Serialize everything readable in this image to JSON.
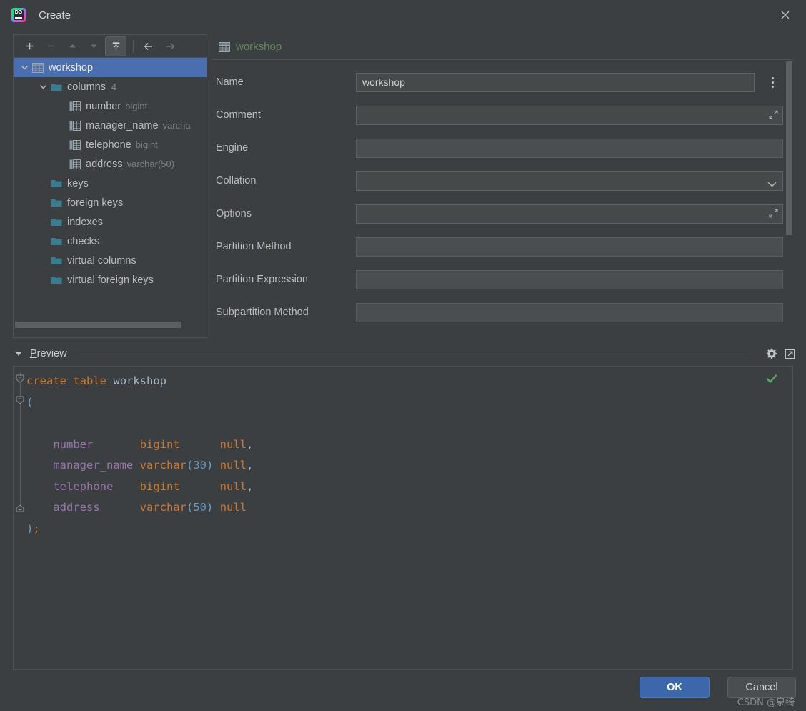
{
  "window": {
    "title": "Create",
    "logo_text": "DG",
    "close_icon": "close-icon"
  },
  "tree_toolbar": {
    "buttons": [
      {
        "name": "add-button",
        "icon": "plus-icon",
        "enabled": true
      },
      {
        "name": "remove-button",
        "icon": "minus-icon",
        "enabled": false
      },
      {
        "name": "move-up-button",
        "icon": "arrow-up-icon",
        "enabled": false
      },
      {
        "name": "move-down-button",
        "icon": "arrow-down-icon",
        "enabled": false
      },
      {
        "name": "expand-button",
        "icon": "push-up-icon",
        "enabled": true
      },
      {
        "name": "back-button",
        "icon": "arrow-left-icon",
        "enabled": true
      },
      {
        "name": "forward-button",
        "icon": "arrow-right-icon",
        "enabled": false
      }
    ]
  },
  "tree": {
    "nodes": [
      {
        "label": "workshop",
        "type": "",
        "count": "",
        "icon": "table-icon",
        "depth": 0,
        "selected": true,
        "expanded": true
      },
      {
        "label": "columns",
        "type": "",
        "count": "4",
        "icon": "folder-icon",
        "depth": 1,
        "selected": false,
        "expanded": true
      },
      {
        "label": "number",
        "type": "bigint",
        "count": "",
        "icon": "column-icon",
        "depth": 2,
        "selected": false,
        "expanded": null
      },
      {
        "label": "manager_name",
        "type": "varcha",
        "count": "",
        "icon": "column-icon",
        "depth": 2,
        "selected": false,
        "expanded": null
      },
      {
        "label": "telephone",
        "type": "bigint",
        "count": "",
        "icon": "column-icon",
        "depth": 2,
        "selected": false,
        "expanded": null
      },
      {
        "label": "address",
        "type": "varchar(50)",
        "count": "",
        "icon": "column-icon",
        "depth": 2,
        "selected": false,
        "expanded": null
      },
      {
        "label": "keys",
        "type": "",
        "count": "",
        "icon": "folder-icon",
        "depth": 1,
        "selected": false,
        "expanded": null
      },
      {
        "label": "foreign keys",
        "type": "",
        "count": "",
        "icon": "folder-icon",
        "depth": 1,
        "selected": false,
        "expanded": null
      },
      {
        "label": "indexes",
        "type": "",
        "count": "",
        "icon": "folder-icon",
        "depth": 1,
        "selected": false,
        "expanded": null
      },
      {
        "label": "checks",
        "type": "",
        "count": "",
        "icon": "folder-icon",
        "depth": 1,
        "selected": false,
        "expanded": null
      },
      {
        "label": "virtual columns",
        "type": "",
        "count": "",
        "icon": "folder-icon",
        "depth": 1,
        "selected": false,
        "expanded": null
      },
      {
        "label": "virtual foreign keys",
        "type": "",
        "count": "",
        "icon": "folder-icon",
        "depth": 1,
        "selected": false,
        "expanded": null
      }
    ]
  },
  "form": {
    "header_title": "workshop",
    "header_icon": "table-icon",
    "fields": [
      {
        "label": "Name",
        "value": "workshop",
        "control": "text",
        "disabled": false,
        "kebab": true,
        "expand": false,
        "chevron": false
      },
      {
        "label": "Comment",
        "value": "",
        "control": "textarea",
        "disabled": false,
        "kebab": false,
        "expand": true,
        "chevron": false
      },
      {
        "label": "Engine",
        "value": "",
        "control": "text",
        "disabled": true,
        "kebab": false,
        "expand": false,
        "chevron": false
      },
      {
        "label": "Collation",
        "value": "",
        "control": "combo",
        "disabled": false,
        "kebab": false,
        "expand": false,
        "chevron": true
      },
      {
        "label": "Options",
        "value": "",
        "control": "textarea",
        "disabled": false,
        "kebab": false,
        "expand": true,
        "chevron": false
      },
      {
        "label": "Partition Method",
        "value": "",
        "control": "text",
        "disabled": true,
        "kebab": false,
        "expand": false,
        "chevron": false
      },
      {
        "label": "Partition Expression",
        "value": "",
        "control": "text",
        "disabled": true,
        "kebab": false,
        "expand": false,
        "chevron": false
      },
      {
        "label": "Subpartition Method",
        "value": "",
        "control": "text",
        "disabled": true,
        "kebab": false,
        "expand": false,
        "chevron": false
      }
    ]
  },
  "preview": {
    "label_prefix": "P",
    "label_rest": "review",
    "collapse_icon": "triangle-down-icon",
    "settings_icon": "gear-icon",
    "popout_icon": "open-external-icon",
    "status_icon": "checkmark-icon"
  },
  "sql": {
    "lines": [
      [
        {
          "t": "create",
          "c": "kw"
        },
        {
          "t": " ",
          "c": "punc"
        },
        {
          "t": "table",
          "c": "kw"
        },
        {
          "t": " ",
          "c": "punc"
        },
        {
          "t": "workshop",
          "c": "tbl"
        }
      ],
      [
        {
          "t": "(",
          "c": "paren"
        }
      ],
      [
        {
          "t": "",
          "c": "punc"
        }
      ],
      [
        {
          "t": "    ",
          "c": "punc"
        },
        {
          "t": "number      ",
          "c": "ident"
        },
        {
          "t": " ",
          "c": "punc"
        },
        {
          "t": "bigint",
          "c": "kw"
        },
        {
          "t": "      ",
          "c": "punc"
        },
        {
          "t": "null",
          "c": "kw"
        },
        {
          "t": ",",
          "c": "punc"
        }
      ],
      [
        {
          "t": "    ",
          "c": "punc"
        },
        {
          "t": "manager_name",
          "c": "ident"
        },
        {
          "t": " ",
          "c": "punc"
        },
        {
          "t": "varchar",
          "c": "kw"
        },
        {
          "t": "(",
          "c": "paren"
        },
        {
          "t": "30",
          "c": "num"
        },
        {
          "t": ")",
          "c": "paren"
        },
        {
          "t": " ",
          "c": "punc"
        },
        {
          "t": "null",
          "c": "kw"
        },
        {
          "t": ",",
          "c": "punc"
        }
      ],
      [
        {
          "t": "    ",
          "c": "punc"
        },
        {
          "t": "telephone   ",
          "c": "ident"
        },
        {
          "t": " ",
          "c": "punc"
        },
        {
          "t": "bigint",
          "c": "kw"
        },
        {
          "t": "      ",
          "c": "punc"
        },
        {
          "t": "null",
          "c": "kw"
        },
        {
          "t": ",",
          "c": "punc"
        }
      ],
      [
        {
          "t": "    ",
          "c": "punc"
        },
        {
          "t": "address     ",
          "c": "ident"
        },
        {
          "t": " ",
          "c": "punc"
        },
        {
          "t": "varchar",
          "c": "kw"
        },
        {
          "t": "(",
          "c": "paren"
        },
        {
          "t": "50",
          "c": "num"
        },
        {
          "t": ")",
          "c": "paren"
        },
        {
          "t": " ",
          "c": "punc"
        },
        {
          "t": "null",
          "c": "kw"
        }
      ],
      [
        {
          "t": ")",
          "c": "paren"
        },
        {
          "t": ";",
          "c": "kw"
        }
      ]
    ],
    "plain_text": "create table workshop\n(\n\n    number       bigint      null,\n    manager_name varchar(30) null,\n    telephone    bigint      null,\n    address      varchar(50) null\n);"
  },
  "footer": {
    "ok_label": "OK",
    "cancel_label": "Cancel",
    "watermark": "CSDN @泉绮"
  },
  "colors": {
    "window_bg": "#3c3f41",
    "selection_blue": "#4b6eaf",
    "accent_green": "#6a8759",
    "ok_button": "#3c68ab",
    "keyword_orange": "#cc7832",
    "identifier_purple": "#9876aa",
    "number_blue": "#6897bb",
    "folder_teal": "#3b7d8f",
    "checkmark_green": "#59a869"
  }
}
